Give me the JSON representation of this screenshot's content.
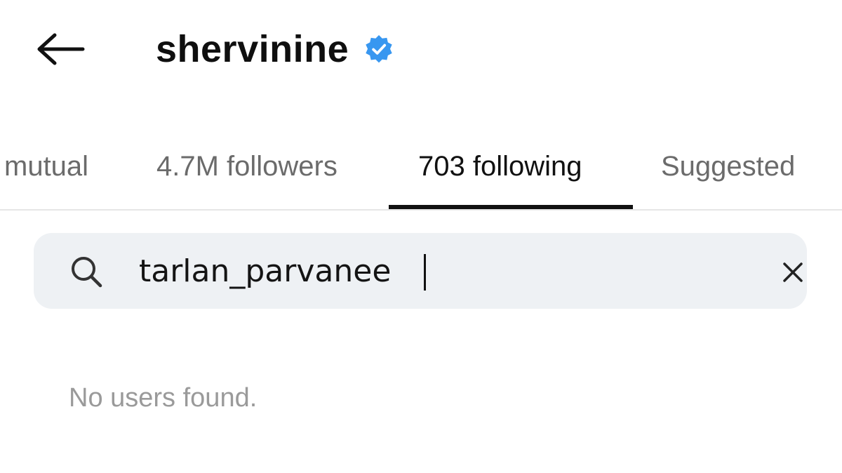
{
  "header": {
    "title": "shervinine",
    "back_icon": "arrow-left-icon",
    "verified_icon": "verified-badge-icon",
    "verified_color": "#3897f0"
  },
  "tabs": [
    {
      "label": "mutual",
      "active": false
    },
    {
      "label": "4.7M followers",
      "active": false
    },
    {
      "label": "703 following",
      "active": true
    },
    {
      "label": "Suggested",
      "active": false
    }
  ],
  "search": {
    "value": "tarlan_parvanee",
    "search_icon": "search-icon",
    "clear_icon": "close-icon"
  },
  "results": {
    "empty_message": "No users found."
  }
}
